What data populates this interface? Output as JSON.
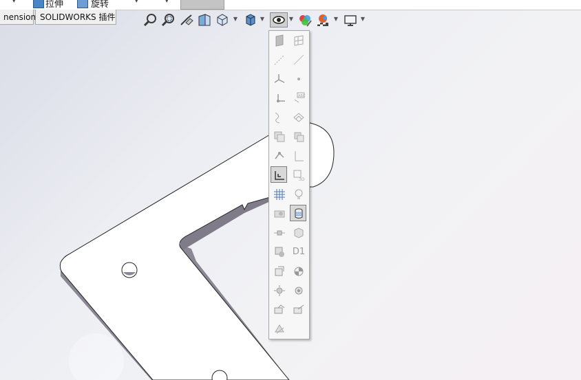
{
  "topbar": {
    "item1_label": "拉伸",
    "item2_label": "旋转"
  },
  "tabs": {
    "dimensions": "nensions",
    "addins": "SOLIDWORKS 插件"
  },
  "heads_up_toolbar": {
    "icons": [
      "zoom-to-fit-icon",
      "zoom-to-area-icon",
      "previous-view-icon",
      "section-view-icon",
      "view-orientation-icon",
      "display-style-icon",
      "hide-show-items-icon",
      "edit-appearance-icon",
      "apply-scene-icon",
      "view-settings-icon"
    ]
  },
  "flyout": {
    "items": [
      "planes",
      "axes",
      "temporary-axes",
      "points",
      "origins",
      "coordinate-systems",
      "curves",
      "sketches",
      "3d-sketch-planes",
      "all-annotations",
      "routing-points",
      "sketch-relations",
      "grid",
      "lights",
      "cameras",
      "cosmetic-threads",
      "weld-beads",
      "dimension-names",
      "parts",
      "decals",
      "centers-of-mass",
      "sketches-hidden",
      "mates",
      "assembly-mates",
      "sensors"
    ],
    "d1_label": "D1",
    "active_items": [
      "sketch-relations",
      "cosmetic-threads-toggle"
    ]
  },
  "colors": {
    "model_face": "#ffffff",
    "model_side": "#8b8794",
    "viewport_bg": "#eceef3"
  }
}
